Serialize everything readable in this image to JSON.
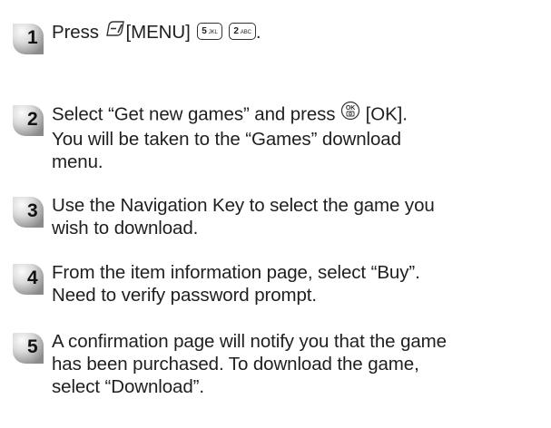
{
  "steps": [
    {
      "number": "1",
      "press_label": "Press",
      "menu_label": "[MENU]",
      "key1_digit": "5",
      "key1_letters": "JKL",
      "key2_digit": "2",
      "key2_letters": "ABC",
      "end_punct": "."
    },
    {
      "number": "2",
      "line1_pre": "Select “Get new games” and press",
      "ok_label": "[OK].",
      "line2": "You will be taken to the “Games” download",
      "line3": "menu."
    },
    {
      "number": "3",
      "line1": "Use the Navigation Key to select the game you",
      "line2": "wish to download."
    },
    {
      "number": "4",
      "line1": "From the item information page, select “Buy”.",
      "line2": "Need to verify password prompt."
    },
    {
      "number": "5",
      "line1": "A confirmation page will notify you that the game",
      "line2": "has been purchased. To download the game,",
      "line3": "select “Download”."
    }
  ],
  "icons": {
    "menu_key": "soft-key-icon",
    "ok_key": "ok-camera-key-icon",
    "step_badge": "step-number-badge"
  },
  "colors": {
    "badge_light": "#f2f2f2",
    "badge_dark": "#8c8c8c",
    "text": "#1f1f1f"
  }
}
